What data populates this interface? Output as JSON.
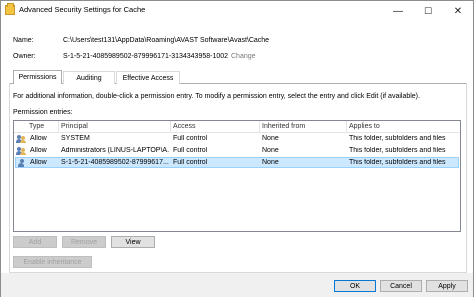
{
  "window": {
    "title": "Advanced Security Settings for Cache",
    "caption_buttons": [
      "—",
      "☐",
      "✕"
    ]
  },
  "details": {
    "name_label": "Name:",
    "name_value": "C:\\Users\\test131\\AppData\\Roaming\\AVAST Software\\Avast\\Cache",
    "owner_label": "Owner:",
    "owner_value": "S-1-5-21-4085989502-879996171-3134343958-1002",
    "change_link": "Change"
  },
  "tabs": [
    {
      "label": "Permissions",
      "active": true
    },
    {
      "label": "Auditing",
      "active": false
    },
    {
      "label": "Effective Access",
      "active": false
    }
  ],
  "permissions": {
    "info_text": "For additional information, double-click a permission entry. To modify a permission entry, select the entry and click Edit (if available).",
    "entries_label": "Permission entries:",
    "columns": [
      "Type",
      "Principal",
      "Access",
      "Inherited from",
      "Applies to"
    ],
    "rows": [
      {
        "type": "Allow",
        "principal": "SYSTEM",
        "access": "Full control",
        "inherited": "None",
        "applies": "This folder, subfolders and files",
        "selected": false
      },
      {
        "type": "Allow",
        "principal": "Administrators (LINUS-LAPTOP\\A...",
        "access": "Full control",
        "inherited": "None",
        "applies": "This folder, subfolders and files",
        "selected": false
      },
      {
        "type": "Allow",
        "principal": "S-1-5-21-4085989502-87999617...",
        "access": "Full control",
        "inherited": "None",
        "applies": "This folder, subfolders and files",
        "selected": true
      }
    ],
    "add_label": "Add",
    "remove_label": "Remove",
    "view_label": "View",
    "enable_inheritance_label": "Enable inheritance"
  },
  "footer": {
    "ok_label": "OK",
    "cancel_label": "Cancel",
    "apply_label": "Apply"
  }
}
